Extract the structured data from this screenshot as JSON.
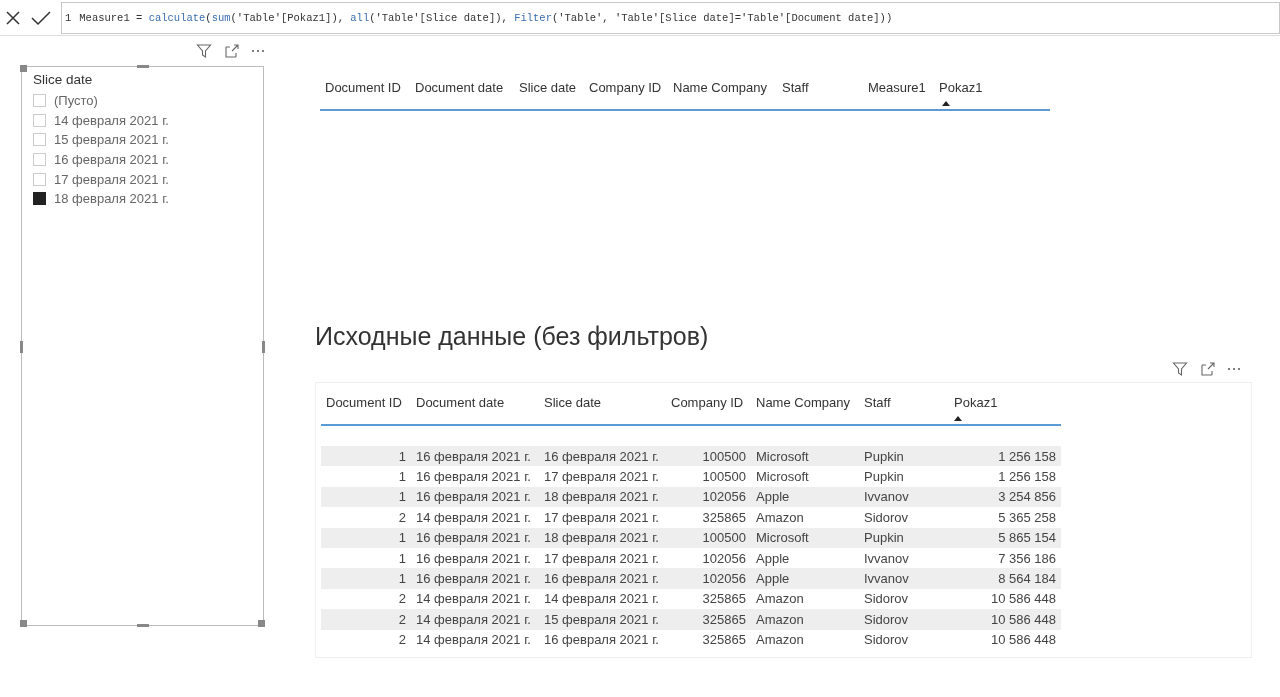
{
  "formula_bar": {
    "line_number": "1",
    "tokens": [
      {
        "kind": "plain",
        "text": "Measure1 = "
      },
      {
        "kind": "function",
        "text": "calculate"
      },
      {
        "kind": "plain",
        "text": "("
      },
      {
        "kind": "function",
        "text": "sum"
      },
      {
        "kind": "plain",
        "text": "('Table'[Pokaz1]), "
      },
      {
        "kind": "function",
        "text": "all"
      },
      {
        "kind": "plain",
        "text": "('Table'[Slice date]), "
      },
      {
        "kind": "function",
        "text": "Filter"
      },
      {
        "kind": "plain",
        "text": "('Table', 'Table'[Slice date]='Table'[Document date]))"
      }
    ]
  },
  "slicer": {
    "title": "Slice date",
    "items": [
      {
        "label": "(Пусто)",
        "checked": false
      },
      {
        "label": "14 февраля 2021 г.",
        "checked": false
      },
      {
        "label": "15 февраля 2021 г.",
        "checked": false
      },
      {
        "label": "16 февраля 2021 г.",
        "checked": false
      },
      {
        "label": "17 февраля 2021 г.",
        "checked": false
      },
      {
        "label": "18 февраля 2021 г.",
        "checked": true
      }
    ]
  },
  "result_section": {
    "table": {
      "columns": [
        {
          "label": "Document ID",
          "sorted": false
        },
        {
          "label": "Document date",
          "sorted": false
        },
        {
          "label": "Slice date",
          "sorted": false
        },
        {
          "label": "Company ID",
          "sorted": false
        },
        {
          "label": "Name Company",
          "sorted": false
        },
        {
          "label": "Staff",
          "sorted": false
        },
        {
          "label": "Measure1",
          "sorted": false
        },
        {
          "label": "Pokaz1",
          "sorted": true
        }
      ]
    }
  },
  "source_section": {
    "title": "Исходные данные (без фильтров)",
    "table": {
      "columns": [
        {
          "label": "Document ID",
          "sorted": false
        },
        {
          "label": "Document date",
          "sorted": false
        },
        {
          "label": "Slice date",
          "sorted": false
        },
        {
          "label": "Company ID",
          "sorted": false
        },
        {
          "label": "Name Company",
          "sorted": false
        },
        {
          "label": "Staff",
          "sorted": false
        },
        {
          "label": "Pokaz1",
          "sorted": true
        }
      ],
      "rows": [
        [
          "1",
          "16 февраля 2021 г.",
          "16 февраля 2021 г.",
          "100500",
          "Microsoft",
          "Pupkin",
          "1 256 158"
        ],
        [
          "1",
          "16 февраля 2021 г.",
          "17 февраля 2021 г.",
          "100500",
          "Microsoft",
          "Pupkin",
          "1 256 158"
        ],
        [
          "1",
          "16 февраля 2021 г.",
          "18 февраля 2021 г.",
          "102056",
          "Apple",
          "Ivvanov",
          "3 254 856"
        ],
        [
          "2",
          "14 февраля 2021 г.",
          "17 февраля 2021 г.",
          "325865",
          "Amazon",
          "Sidorov",
          "5 365 258"
        ],
        [
          "1",
          "16 февраля 2021 г.",
          "18 февраля 2021 г.",
          "100500",
          "Microsoft",
          "Pupkin",
          "5 865 154"
        ],
        [
          "1",
          "16 февраля 2021 г.",
          "17 февраля 2021 г.",
          "102056",
          "Apple",
          "Ivvanov",
          "7 356 186"
        ],
        [
          "1",
          "16 февраля 2021 г.",
          "16 февраля 2021 г.",
          "102056",
          "Apple",
          "Ivvanov",
          "8 564 184"
        ],
        [
          "2",
          "14 февраля 2021 г.",
          "14 февраля 2021 г.",
          "325865",
          "Amazon",
          "Sidorov",
          "10 586 448"
        ],
        [
          "2",
          "14 февраля 2021 г.",
          "15 февраля 2021 г.",
          "325865",
          "Amazon",
          "Sidorov",
          "10 586 448"
        ],
        [
          "2",
          "14 февраля 2021 г.",
          "16 февраля 2021 г.",
          "325865",
          "Amazon",
          "Sidorov",
          "10 586 448"
        ]
      ]
    }
  }
}
